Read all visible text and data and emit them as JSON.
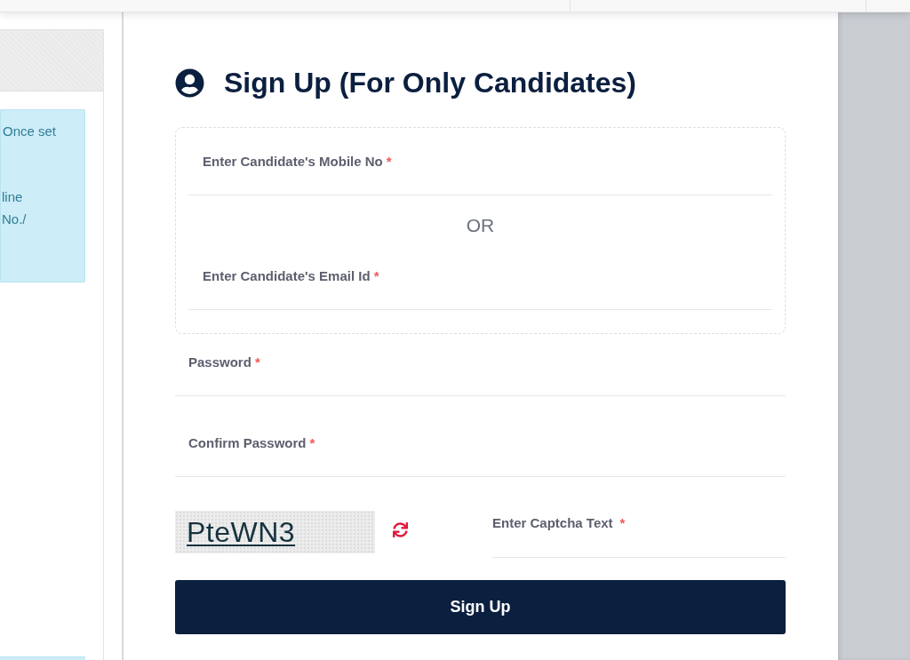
{
  "left_panel": {
    "info_lines": [
      "Once set",
      "line",
      "No./"
    ]
  },
  "form": {
    "title": "Sign Up (For Only Candidates)",
    "contact_group": {
      "mobile": {
        "label": "Enter Candidate's Mobile No",
        "required_mark": "*"
      },
      "separator": "OR",
      "email": {
        "label": "Enter Candidate's Email Id",
        "required_mark": "*"
      }
    },
    "password": {
      "label": "Password",
      "required_mark": "*"
    },
    "confirm_password": {
      "label": "Confirm Password",
      "required_mark": "*"
    },
    "captcha": {
      "image_text": "PteWN3",
      "input": {
        "label": "Enter Captcha Text",
        "required_mark": "*"
      }
    },
    "submit_button": "Sign Up"
  }
}
